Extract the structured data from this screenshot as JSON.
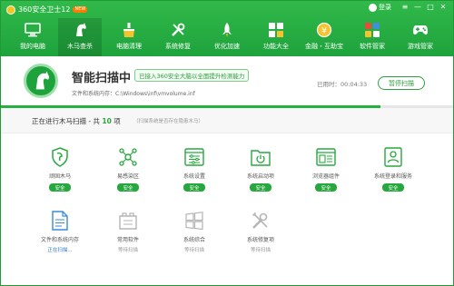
{
  "window": {
    "title": "360安全卫士12",
    "title_badge": "NEW",
    "login_label": "登录",
    "controls": [
      "≡",
      "—",
      "□",
      "✕"
    ]
  },
  "nav": {
    "items": [
      {
        "label": "我的电脑",
        "icon": "monitor-icon",
        "active": false
      },
      {
        "label": "木马查杀",
        "icon": "horse-icon",
        "active": true
      },
      {
        "label": "电脑清理",
        "icon": "broom-icon",
        "active": false
      },
      {
        "label": "系统修复",
        "icon": "wrench-icon",
        "active": false
      },
      {
        "label": "优化加速",
        "icon": "rocket-icon",
        "active": false
      },
      {
        "label": "功能大全",
        "icon": "grid-icon",
        "active": false
      },
      {
        "label": "金融・互助宝",
        "icon": "coin-icon",
        "active": false
      },
      {
        "label": "软件管家",
        "icon": "apps-icon",
        "active": false
      },
      {
        "label": "游戏管家",
        "icon": "gamepad-icon",
        "active": false
      }
    ]
  },
  "scan": {
    "title": "智能扫描中",
    "tag": "已接入360安全大脑以全面提升检测能力",
    "file": "文件和系统内存：C:\\Windows\\inf\\vmvolume.inf",
    "elapsed": "已用时：00:04:33",
    "pause_label": "暂停扫描",
    "progress": 0.84
  },
  "info": {
    "prefix": "正在进行木马扫描 - 共",
    "count": "10",
    "suffix": "项",
    "note": "（扫描系统是否存在隐患木马）"
  },
  "items": [
    {
      "name": "顽固木马",
      "icon": "shield-icon",
      "status": "安全",
      "state": "safe"
    },
    {
      "name": "易感染区",
      "icon": "molecule-icon",
      "status": "安全",
      "state": "safe"
    },
    {
      "name": "系统设置",
      "icon": "settings-window-icon",
      "status": "安全",
      "state": "safe"
    },
    {
      "name": "系统启动项",
      "icon": "power-folder-icon",
      "status": "安全",
      "state": "safe"
    },
    {
      "name": "浏览器组件",
      "icon": "browser-icon",
      "status": "安全",
      "state": "safe"
    },
    {
      "name": "系统登录和服务",
      "icon": "user-card-icon",
      "status": "安全",
      "state": "safe"
    },
    {
      "name": "文件和系统内存",
      "icon": "document-icon",
      "status": "正在扫描...",
      "state": "active"
    },
    {
      "name": "常用软件",
      "icon": "software-box-icon",
      "status": "等待扫描",
      "state": "waiting"
    },
    {
      "name": "系统综合",
      "icon": "windows-icon",
      "status": "等待扫描",
      "state": "waiting"
    },
    {
      "name": "系统修复项",
      "icon": "tools-icon",
      "status": "等待扫描",
      "state": "waiting"
    }
  ],
  "colors": {
    "brand_green": "#1ea33c",
    "safe_green": "#27a83e",
    "scanning_blue": "#2a7bd4",
    "waiting_gray": "#999999"
  }
}
